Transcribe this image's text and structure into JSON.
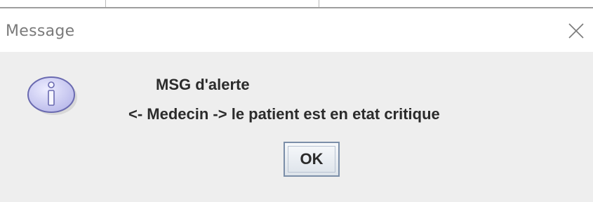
{
  "window": {
    "title": "Message",
    "close_icon": "close-icon"
  },
  "dialog": {
    "icon": "information-icon",
    "heading": "MSG d'alerte",
    "message": "<- Medecin -> le patient est en etat critique",
    "ok_label": "OK"
  },
  "colors": {
    "background": "#eeeeee",
    "titlebar": "#ffffff",
    "icon_fill": "#c9c9f0",
    "icon_border": "#6a6ab0",
    "button_border": "#7b8ea8",
    "text": "#2b2b2b"
  }
}
